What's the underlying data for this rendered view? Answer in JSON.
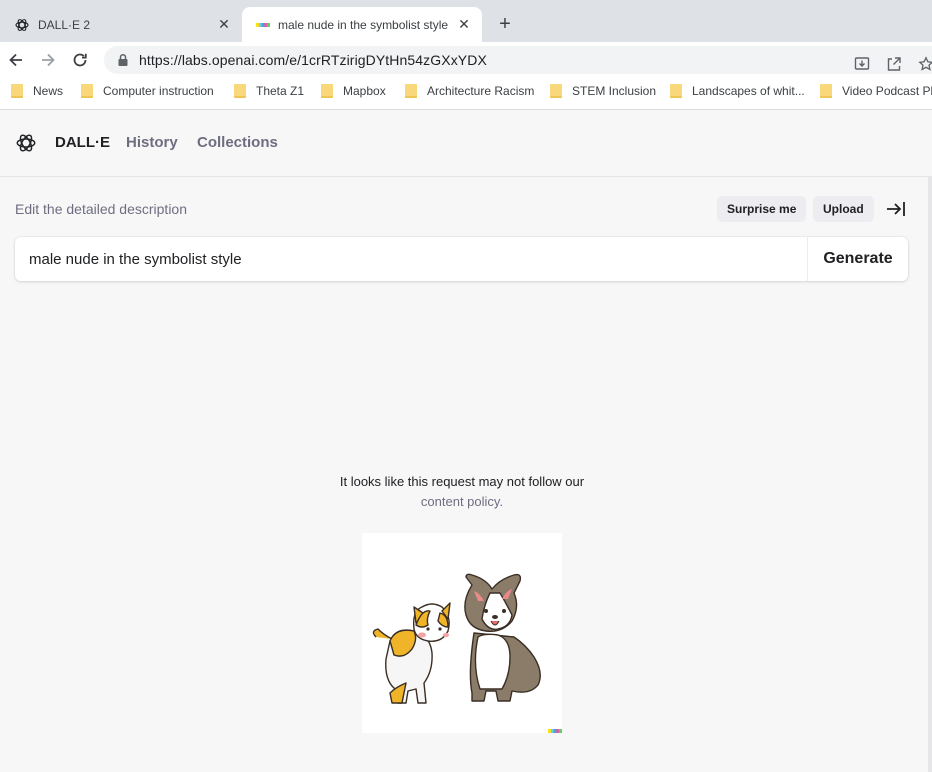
{
  "browser": {
    "tabs": [
      {
        "title": "DALL·E 2",
        "active": false
      },
      {
        "title": "male nude in the symbolist style",
        "active": true
      }
    ],
    "url": "https://labs.openai.com/e/1crRTzirigDYtHn54zGXxYDX",
    "bookmarks": [
      "News",
      "Computer instruction",
      "Theta Z1",
      "Mapbox",
      "Architecture Racism",
      "STEM Inclusion",
      "Landscapes of whit...",
      "Video Podcast Pl"
    ]
  },
  "app": {
    "brand": "DALL·E",
    "nav": [
      "History",
      "Collections"
    ],
    "edit_label": "Edit the detailed description",
    "surprise_label": "Surprise me",
    "upload_label": "Upload",
    "prompt_value": "male nude in the symbolist style",
    "generate_label": "Generate",
    "policy_line1": "It looks like this request may not follow our",
    "policy_line2": "content policy."
  },
  "colors": {
    "page_bg": "#f7f7f8",
    "text_primary": "#202123",
    "text_secondary": "#6e6e80",
    "pill_bg": "#ececf1"
  },
  "icons": {
    "back": "arrow-left-icon",
    "forward": "arrow-right-icon",
    "reload": "reload-icon",
    "lock": "lock-icon",
    "install": "install-icon",
    "share": "share-icon",
    "star": "star-icon",
    "collapse": "collapse-panel-icon",
    "illustration": "corgi-and-kitten-illustration"
  }
}
